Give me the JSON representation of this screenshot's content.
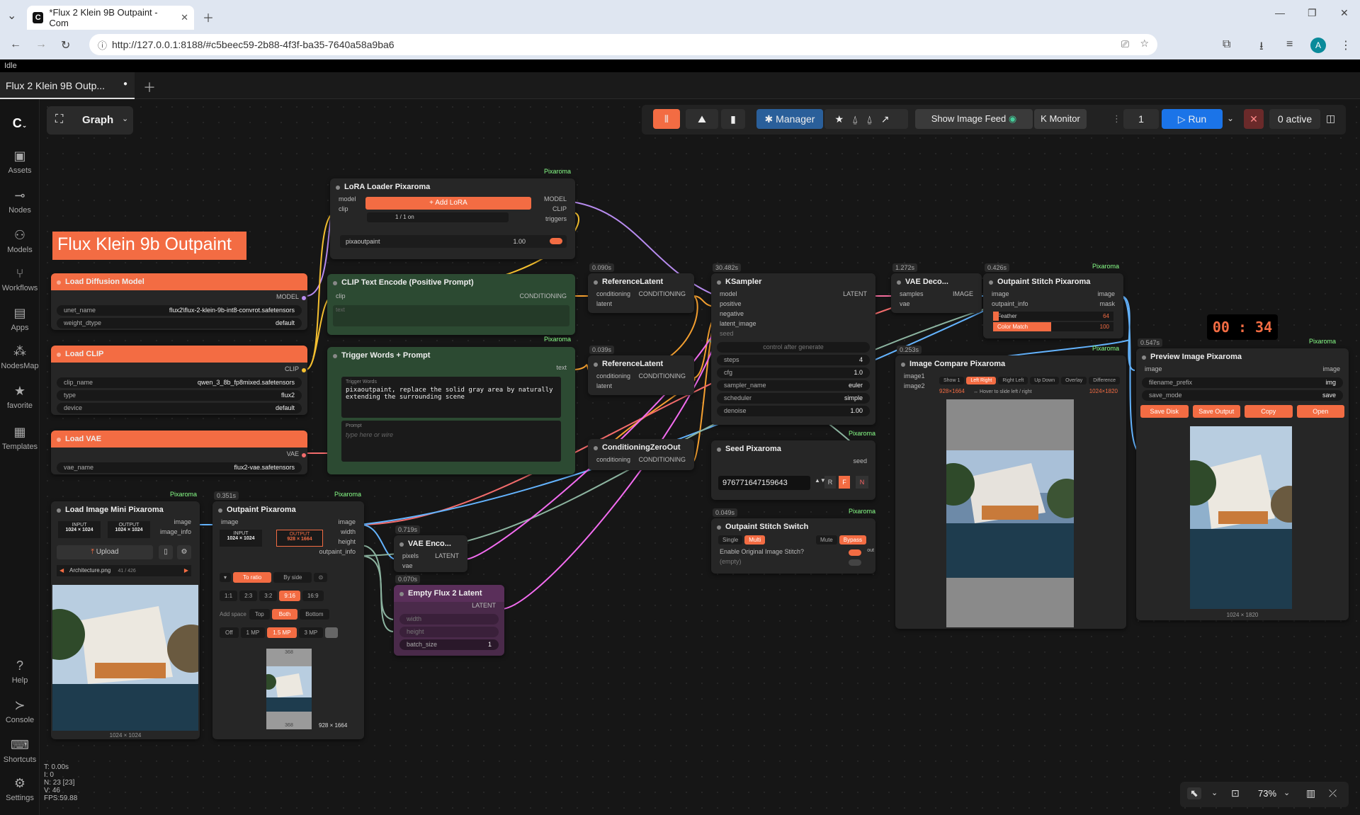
{
  "browser": {
    "tab_title": "*Flux 2 Klein 9B Outpaint - Com",
    "url": "http://127.0.0.1:8188/#c5beec59-2b88-4f3f-ba35-7640a58a9ba6",
    "profile": "A"
  },
  "status": "Idle",
  "workflow_tab": "Flux 2 Klein 9B Outp...",
  "sidebar": [
    {
      "label": "Assets",
      "icon": "image-icon"
    },
    {
      "label": "Nodes",
      "icon": "nodes-icon"
    },
    {
      "label": "Models",
      "icon": "models-icon"
    },
    {
      "label": "Workflows",
      "icon": "workflow-icon"
    },
    {
      "label": "Apps",
      "icon": "apps-icon"
    },
    {
      "label": "NodesMap",
      "icon": "nodesmap-icon"
    },
    {
      "label": "favorite",
      "icon": "star-icon"
    },
    {
      "label": "Templates",
      "icon": "templates-icon"
    },
    {
      "label": "Help",
      "icon": "help-icon"
    },
    {
      "label": "Console",
      "icon": "console-icon"
    },
    {
      "label": "Shortcuts",
      "icon": "keyboard-icon"
    },
    {
      "label": "Settings",
      "icon": "gear-icon"
    }
  ],
  "graph_label": "Graph",
  "toolbar": {
    "manager": "Manager",
    "show_feed": "Show Image Feed",
    "monitor": "Monitor",
    "queue_count": "1",
    "run": "Run",
    "active": "0 active"
  },
  "title_note": "Flux Klein 9b Outpaint",
  "pixaroma": "Pixaroma",
  "nodes": {
    "lora": {
      "title": "LoRA Loader Pixaroma",
      "in1": "model",
      "in2": "clip",
      "out1": "MODEL",
      "out2": "CLIP",
      "out3": "triggers",
      "add": "+ Add LoRA",
      "count": "1 / 1 on",
      "lora_name": "pixaoutpaint",
      "strength": "1.00"
    },
    "diffusion": {
      "title": "Load Diffusion Model",
      "out": "MODEL",
      "w1l": "unet_name",
      "w1v": "flux2\\flux-2-klein-9b-int8-convrot.safetensors",
      "w2l": "weight_dtype",
      "w2v": "default"
    },
    "clip": {
      "title": "Load CLIP",
      "out": "CLIP",
      "w1l": "clip_name",
      "w1v": "qwen_3_8b_fp8mixed.safetensors",
      "w2l": "type",
      "w2v": "flux2",
      "w3l": "device",
      "w3v": "default"
    },
    "vae": {
      "title": "Load VAE",
      "out": "VAE",
      "w1l": "vae_name",
      "w1v": "flux2-vae.safetensors"
    },
    "clipenc": {
      "title": "CLIP Text Encode (Positive Prompt)",
      "in": "clip",
      "out": "CONDITIONING",
      "text": "text"
    },
    "trigger": {
      "title": "Trigger Words + Prompt",
      "out": "text",
      "lbl1": "Trigger Words",
      "text1": "pixaoutpaint, replace the solid gray area by naturally extending the surrounding scene",
      "lbl2": "Prompt",
      "placeholder": "type here or wire"
    },
    "ref1": {
      "title": "ReferenceLatent",
      "time": "0.090s",
      "in1": "conditioning",
      "in2": "latent",
      "out": "CONDITIONING"
    },
    "ref2": {
      "title": "ReferenceLatent",
      "time": "0.039s",
      "in1": "conditioning",
      "in2": "latent",
      "out": "CONDITIONING"
    },
    "czero": {
      "title": "ConditioningZeroOut",
      "in": "conditioning",
      "out": "CONDITIONING"
    },
    "ksampler": {
      "title": "KSampler",
      "time": "30.482s",
      "in1": "model",
      "in2": "positive",
      "in3": "negative",
      "in4": "latent_image",
      "in5": "seed",
      "out": "LATENT",
      "cag": "control after generate",
      "steps": "4",
      "cfg": "1.0",
      "sampler": "euler",
      "scheduler": "simple",
      "denoise": "1.00",
      "l_steps": "steps",
      "l_cfg": "cfg",
      "l_sampler": "sampler_name",
      "l_sched": "scheduler",
      "l_denoise": "denoise"
    },
    "vaedec": {
      "title": "VAE Deco...",
      "time": "1.272s",
      "in1": "samples",
      "in2": "vae",
      "out": "IMAGE"
    },
    "stitch": {
      "title": "Outpaint Stitch Pixaroma",
      "time": "0.426s",
      "in1": "image",
      "in2": "outpaint_info",
      "out1": "image",
      "out2": "mask",
      "feather": "Feather",
      "feather_v": "64",
      "color": "Color Match",
      "color_v": "100"
    },
    "seed": {
      "title": "Seed Pixaroma",
      "out": "seed",
      "value": "976771647159643",
      "r": "R",
      "f": "F",
      "n": "N"
    },
    "switch": {
      "title": "Outpaint Stitch Switch",
      "time": "0.049s",
      "single": "Single",
      "multi": "Multi",
      "mute": "Mute",
      "bypass": "Bypass",
      "enable": "Enable Original Image Stitch?",
      "empty": "(empty)",
      "out": "out"
    },
    "compare": {
      "title": "Image Compare Pixaroma",
      "time": "0.253s",
      "in1": "image1",
      "in2": "image2",
      "tabs": [
        "Show 1",
        "Left Right",
        "Right Left",
        "Up Down",
        "Overlay",
        "Difference"
      ],
      "s1": "928×1664",
      "hint": "↔ Hover to slide left / right",
      "s2": "1024×1820"
    },
    "preview": {
      "title": "Preview Image Pixaroma",
      "time": "0.547s",
      "in": "image",
      "out": "image",
      "prefix_l": "filename_prefix",
      "prefix_v": "img",
      "save_l": "save_mode",
      "save_v": "save",
      "b1": "Save Disk",
      "b2": "Save Output",
      "b3": "Copy",
      "b4": "Open",
      "size": "1024 × 1820"
    },
    "loadimg": {
      "title": "Load Image Mini Pixaroma",
      "out1": "image",
      "out2": "image_info",
      "input": "INPUT",
      "input_v": "1024 × 1024",
      "output": "OUTPUT",
      "output_v": "1024 × 1024",
      "upload": "Upload",
      "file": "Architecture.png",
      "count": "41 / 426",
      "size": "1024 × 1024"
    },
    "outpaint": {
      "title": "Outpaint Pixaroma",
      "time": "0.351s",
      "in": "image",
      "out1": "image",
      "out2": "width",
      "out3": "height",
      "out4": "outpaint_info",
      "input": "INPUT",
      "input_v": "1024 × 1024",
      "output": "OUTPUT",
      "output_v": "928 × 1664",
      "m1": "To ratio",
      "m2": "By side",
      "ratios": [
        "1:1",
        "2:3",
        "3:2",
        "9:16",
        "16:9"
      ],
      "addspace": "Add space",
      "sides": [
        "Top",
        "Both",
        "Bottom"
      ],
      "mp": [
        "Off",
        "1 MP",
        "1.5 MP",
        "3 MP"
      ],
      "pad": "368",
      "size": "928 × 1664"
    },
    "vaeenc": {
      "title": "VAE Enco...",
      "time": "0.719s",
      "in1": "pixels",
      "in2": "vae",
      "out": "LATENT"
    },
    "empty": {
      "title": "Empty Flux 2 Latent",
      "time": "0.070s",
      "out": "LATENT",
      "w1": "width",
      "w2": "height",
      "w3": "batch_size",
      "w3v": "1"
    }
  },
  "timer": "00 : 34",
  "zoom": "73%",
  "stats": [
    "T: 0.00s",
    "I: 0",
    "N: 23 [23]",
    "V: 46",
    "FPS:59.88"
  ],
  "colors": {
    "accent": "#f36c43",
    "run": "#1b74e8",
    "green_node": "#2c4a32",
    "purple_node": "#4a2a4a"
  }
}
